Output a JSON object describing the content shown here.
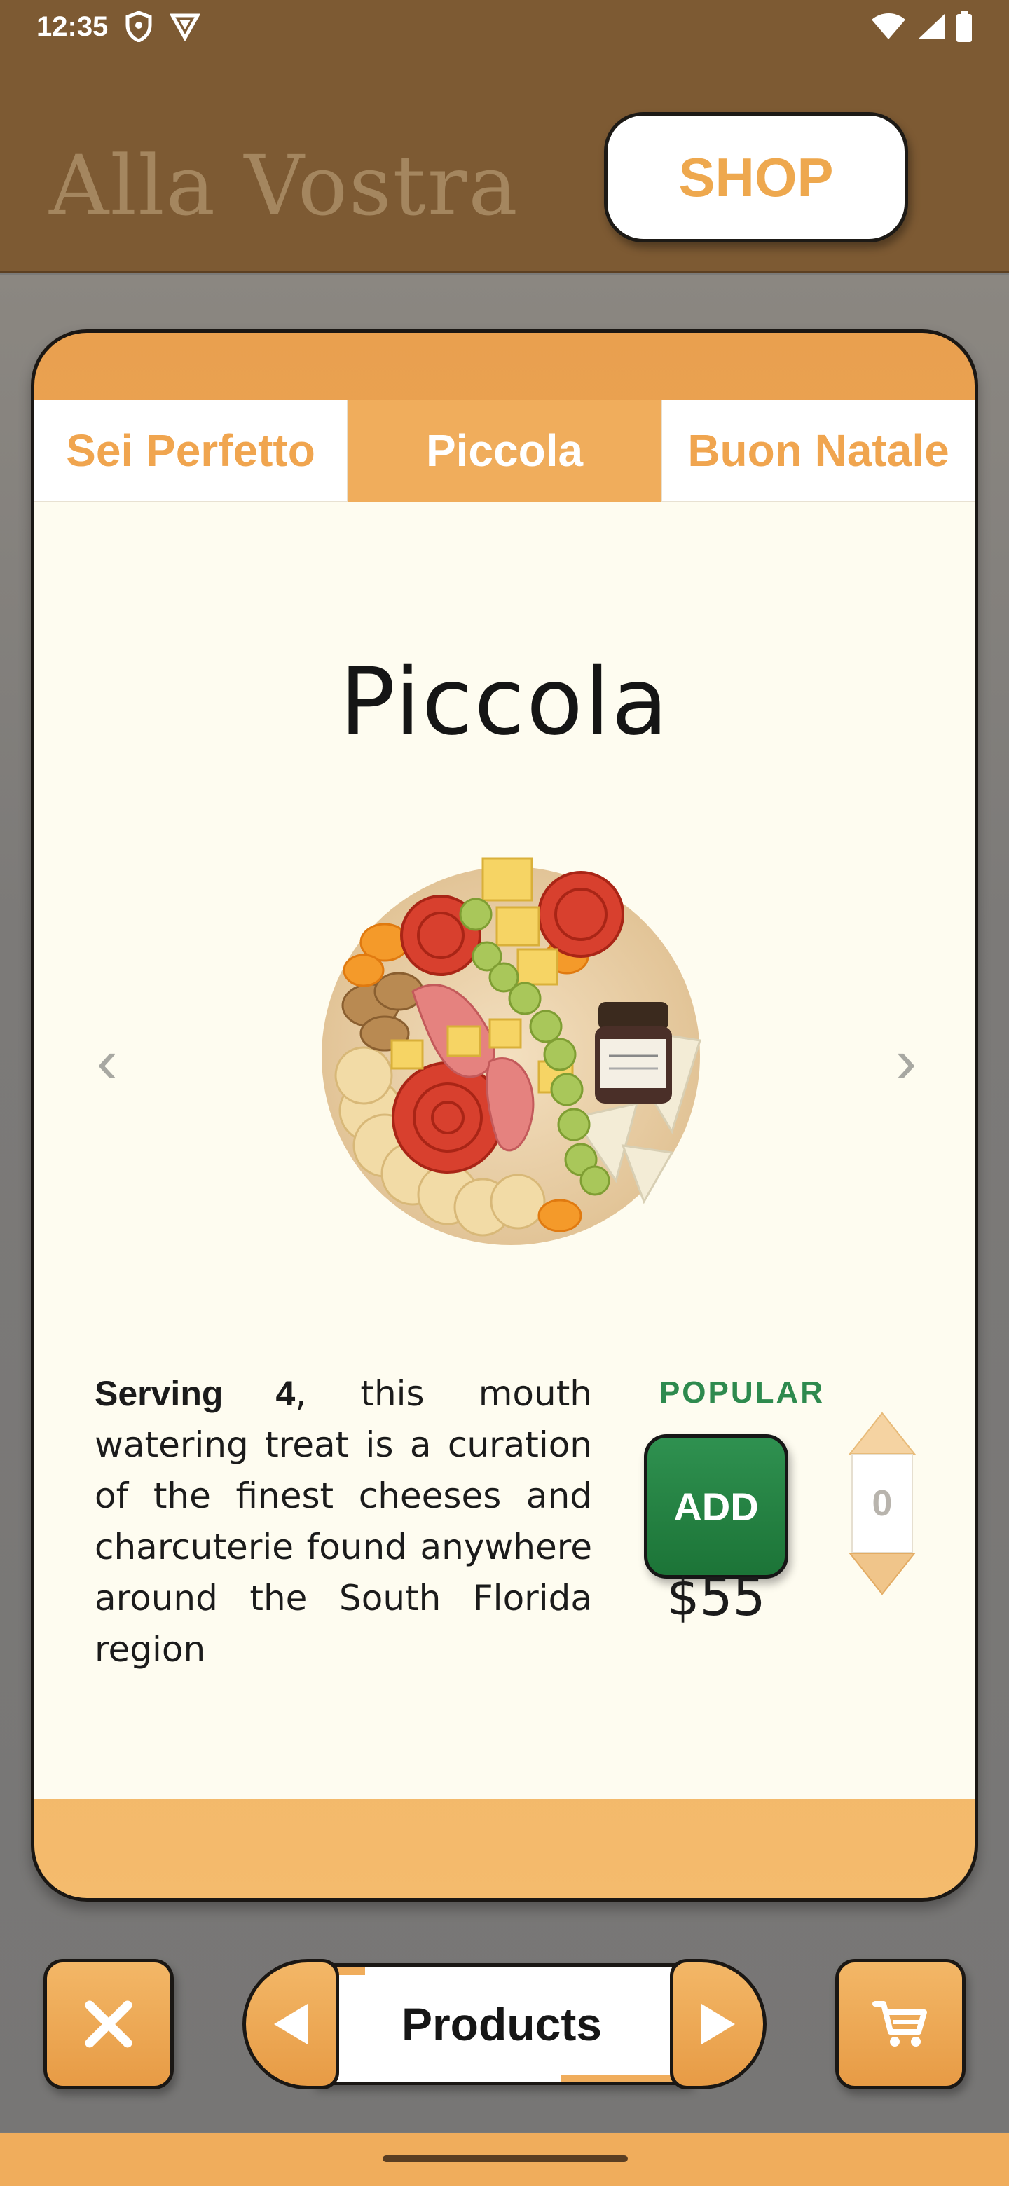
{
  "status_bar": {
    "time": "12:35",
    "left_icons": [
      "shield-icon",
      "vpn-triangle-icon"
    ],
    "right_icons": [
      "wifi-icon",
      "signal-icon",
      "battery-icon"
    ]
  },
  "header": {
    "brand": "Alla Vostra",
    "shop_label": "SHOP",
    "background": "#7d5a33"
  },
  "tabs": [
    {
      "label": "Sei Perfetto",
      "active": false
    },
    {
      "label": "Piccola",
      "active": true
    },
    {
      "label": "Buon Natale",
      "active": false
    }
  ],
  "product": {
    "title": "Piccola",
    "image_icon": "charcuterie-platter-image",
    "description_bold": "Serving 4",
    "description_rest": ", this mouth watering treat is a curation of the finest cheeses and charcuterie found anywhere around the South Florida region",
    "badge": "POPULAR",
    "add_label": "ADD",
    "price": "$55",
    "quantity": "0"
  },
  "carousel": {
    "prev_glyph": "‹",
    "next_glyph": "›"
  },
  "bottom_nav": {
    "center_label": "Products",
    "close_icon": "close-icon",
    "cart_icon": "cart-icon"
  },
  "colors": {
    "accent": "#f0ad5c",
    "brown": "#7d5a33",
    "green": "#2e8a4e",
    "card_bg": "#fefcf0"
  }
}
